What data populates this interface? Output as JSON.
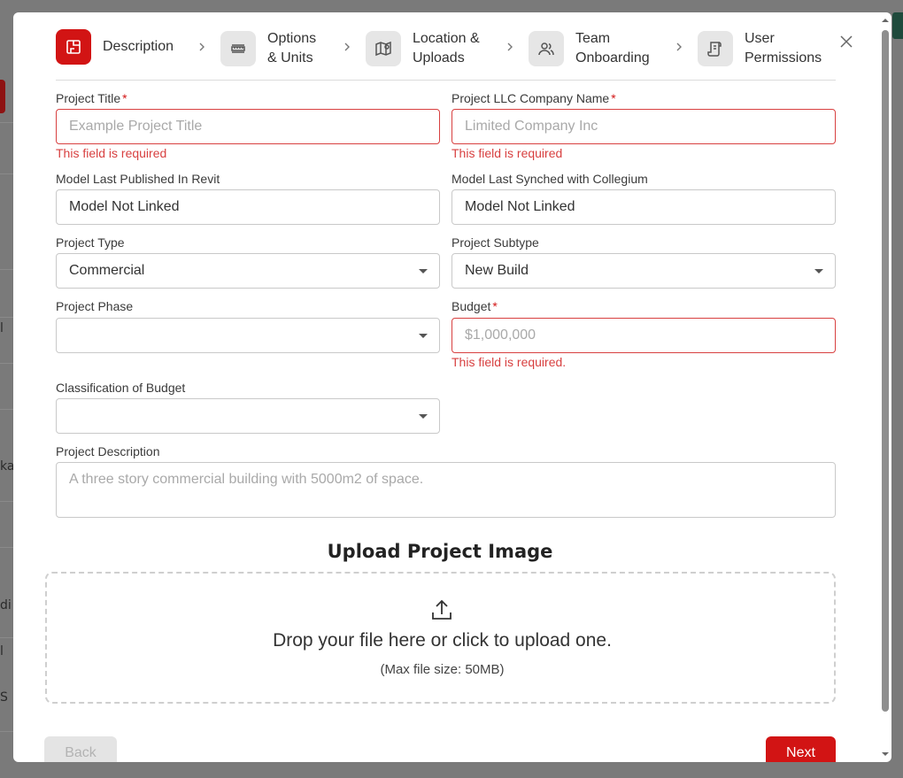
{
  "background": {
    "fragments": [
      "l",
      "ka",
      "di",
      "l",
      "S"
    ]
  },
  "stepper": {
    "steps": [
      {
        "label_line1": "Description",
        "label_line2": "",
        "icon": "building-plan-icon",
        "active": true
      },
      {
        "label_line1": "Options",
        "label_line2": "& Units",
        "icon": "ruler-icon",
        "active": false
      },
      {
        "label_line1": "Location &",
        "label_line2": "Uploads",
        "icon": "map-pin-icon",
        "active": false
      },
      {
        "label_line1": "Team",
        "label_line2": "Onboarding",
        "icon": "users-icon",
        "active": false
      },
      {
        "label_line1": "User",
        "label_line2": "Permissions",
        "icon": "document-icon",
        "active": false
      }
    ]
  },
  "form": {
    "project_title": {
      "label": "Project Title",
      "required_mark": "*",
      "placeholder": "Example Project Title",
      "error": "This field is required"
    },
    "llc_name": {
      "label": "Project LLC Company Name",
      "required_mark": "*",
      "placeholder": "Limited Company Inc",
      "error": "This field is required"
    },
    "model_revit": {
      "label": "Model Last Published In Revit",
      "value": "Model Not Linked"
    },
    "model_collegium": {
      "label": "Model Last Synched with Collegium",
      "value": "Model Not Linked"
    },
    "project_type": {
      "label": "Project Type",
      "value": "Commercial"
    },
    "project_subtype": {
      "label": "Project Subtype",
      "value": "New Build"
    },
    "project_phase": {
      "label": "Project Phase",
      "value": ""
    },
    "budget": {
      "label": "Budget",
      "required_mark": "*",
      "placeholder": "$1,000,000",
      "error": "This field is required."
    },
    "budget_class": {
      "label": "Classification of Budget",
      "value": ""
    },
    "description": {
      "label": "Project Description",
      "placeholder": "A three story commercial building with 5000m2 of space."
    }
  },
  "upload": {
    "title": "Upload Project Image",
    "drop_text": "Drop your file here or click to upload one.",
    "max_size": "(Max file size: 50MB)"
  },
  "buttons": {
    "back": "Back",
    "next": "Next"
  },
  "colors": {
    "accent": "#d21414",
    "error": "#d84040"
  }
}
